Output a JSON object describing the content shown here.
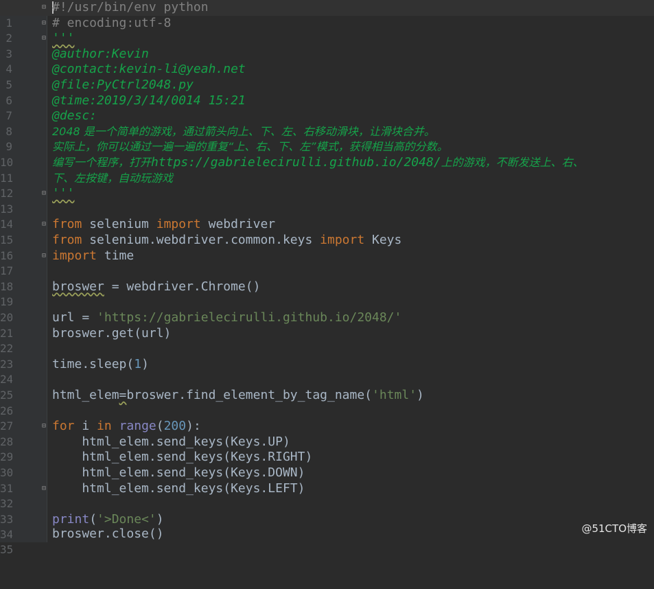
{
  "editor": {
    "line_numbers": [
      "1",
      "2",
      "3",
      "4",
      "5",
      "6",
      "7",
      "8",
      "9",
      "10",
      "11",
      "12",
      "13",
      "14",
      "15",
      "16",
      "17",
      "18",
      "19",
      "20",
      "21",
      "22",
      "23",
      "24",
      "25",
      "26",
      "27",
      "28",
      "29",
      "30",
      "31",
      "32",
      "33",
      "34",
      "35"
    ],
    "code": {
      "l1": "#!/usr/bin/env python",
      "l2": "# encoding:utf-8",
      "l3": "'''",
      "l4": "@author:Kevin",
      "l5": "@contact:kevin-li@yeah.net",
      "l6": "@file:PyCtrl2048.py",
      "l7": "@time:2019/3/14/0014 15:21",
      "l8": "@desc:",
      "l9": "2048 是一个简单的游戏，通过箭头向上、下、左、右移动滑块，让滑块合并。",
      "l10": "实际上，你可以通过一遍一遍的重复“上、右、下、左”模式，获得相当高的分数。",
      "l11a": "编写一个程序，打开",
      "l11b": "https://gabrielecirulli.github.io/2048/",
      "l11c": "上的游戏，不断发送上、右、",
      "l12": "下、左按键，自动玩游戏",
      "l13": "'''",
      "kw_from": "from",
      "kw_import": "import",
      "kw_for": "for",
      "kw_in": "in",
      "l15_mod": " selenium ",
      "l15_name": " webdriver",
      "l16_mod": " selenium.webdriver.common.keys ",
      "l16_name": " Keys",
      "l17_name": " time",
      "l19_var": "broswer",
      "l19_rest": " = webdriver.Chrome()",
      "l21_a": "url = ",
      "l21_str": "'https://gabrielecirulli.github.io/2048/'",
      "l22": "broswer.get(url)",
      "l24_a": "time.sleep(",
      "l24_num": "1",
      "l24_b": ")",
      "l26_a": "html_elem",
      "l26_eq": "=",
      "l26_b": "broswer.find_element_by_tag_name(",
      "l26_str": "'html'",
      "l26_c": ")",
      "l28_i": " i ",
      "l28_range": "range",
      "l28_open": "(",
      "l28_num": "200",
      "l28_close": "):",
      "l29": "    html_elem.send_keys(Keys.UP)",
      "l30": "    html_elem.send_keys(Keys.RIGHT)",
      "l31": "    html_elem.send_keys(Keys.DOWN)",
      "l32": "    html_elem.send_keys(Keys.LEFT)",
      "l34_print": "print",
      "l34_open": "(",
      "l34_str": "'>Done<'",
      "l34_close": ")",
      "l35": "broswer.close()"
    },
    "colors": {
      "background": "#2b2b2b",
      "keyword": "#cc7832",
      "docstring": "#16a34a",
      "string": "#6a8759",
      "number": "#6897bb",
      "builtin": "#8888c6",
      "default_text": "#a9b7c6"
    }
  },
  "watermark": "@51CTO博客"
}
